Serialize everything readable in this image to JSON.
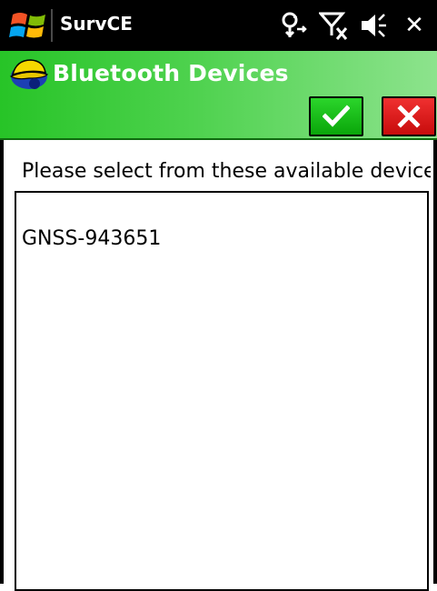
{
  "system_bar": {
    "app_title": "SurvCE",
    "icons": [
      "bluetooth-connectivity-icon",
      "signal-off-icon",
      "speaker-icon",
      "close-icon"
    ]
  },
  "header": {
    "title": "Bluetooth Devices",
    "ok_icon": "check-icon",
    "cancel_icon": "x-icon",
    "colors": {
      "green_start": "#27c427",
      "green_end": "#8de38d",
      "ok_button": "#0fb40f",
      "cancel_button": "#d81414"
    }
  },
  "main": {
    "prompt": "Please select from these available device",
    "devices": [
      {
        "name": "GNSS-943651"
      }
    ]
  }
}
